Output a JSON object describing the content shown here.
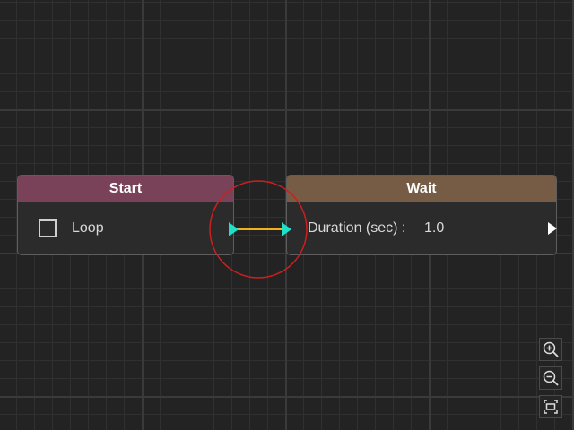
{
  "canvas": {
    "grid_color": "#3a3a3a",
    "background_color": "#232323"
  },
  "nodes": {
    "start": {
      "title": "Start",
      "header_color": "#7a4258",
      "field": {
        "label": "Loop",
        "checked": false
      }
    },
    "wait": {
      "title": "Wait",
      "header_color": "#765c45",
      "field": {
        "label": "Duration (sec) :",
        "value": "1.0"
      }
    }
  },
  "connection": {
    "from": "Start",
    "to": "Wait",
    "line_color": "#f0b020",
    "port_color": "#1fe0c8",
    "highlight_color": "#cc1f1f"
  },
  "zoom_controls": {
    "zoom_in_icon": "zoom-in-icon",
    "zoom_out_icon": "zoom-out-icon",
    "fit_icon": "fit-view-icon"
  }
}
